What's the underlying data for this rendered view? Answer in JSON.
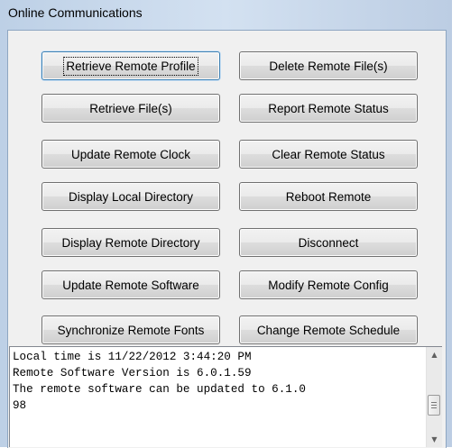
{
  "window": {
    "title": "Online Communications"
  },
  "buttons": {
    "retrieve_remote_profile": "Retrieve Remote Profile",
    "delete_remote_files": "Delete Remote File(s)",
    "retrieve_files": "Retrieve File(s)",
    "report_remote_status": "Report Remote Status",
    "update_remote_clock": "Update Remote Clock",
    "clear_remote_status": "Clear Remote Status",
    "display_local_directory": "Display Local Directory",
    "reboot_remote": "Reboot Remote",
    "display_remote_directory": "Display Remote Directory",
    "disconnect": "Disconnect",
    "update_remote_software": "Update Remote Software",
    "modify_remote_config": "Modify Remote Config",
    "synchronize_remote_fonts": "Synchronize Remote Fonts",
    "change_remote_schedule": "Change Remote Schedule"
  },
  "output": {
    "text": "Local time is 11/22/2012 3:44:20 PM\nRemote Software Version is 6.0.1.59\nThe remote software can be updated to 6.1.0\n98"
  },
  "icons": {
    "scroll_up": "scroll-up-arrow",
    "scroll_down": "scroll-down-arrow",
    "thumb_grip": "grip"
  }
}
